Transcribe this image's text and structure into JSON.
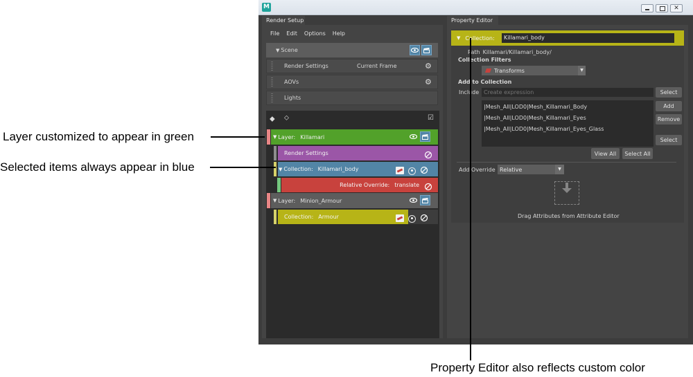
{
  "annotations": {
    "green": "Layer customized to appear in green",
    "blue": "Selected items always appear in blue",
    "property": "Property Editor also reflects custom color"
  },
  "window": {
    "app_icon": "M",
    "controls": [
      "minimize-icon",
      "restore-icon",
      "close-icon"
    ]
  },
  "render_setup": {
    "tab": "Render Setup",
    "menu": [
      "File",
      "Edit",
      "Options",
      "Help"
    ],
    "scene": {
      "label": "Scene",
      "items": [
        {
          "label": "Render Settings",
          "value": "Current Frame"
        },
        {
          "label": "AOVs",
          "value": ""
        },
        {
          "label": "Lights",
          "value": ""
        }
      ]
    },
    "tree": {
      "layer1": {
        "prefix": "Layer:",
        "name": "Killamari",
        "color": "#52a12a"
      },
      "render_settings": {
        "label": "Render Settings",
        "color": "#9b56a7"
      },
      "collection1": {
        "prefix": "Collection:",
        "name": "Killamari_body",
        "color": "#5285a6"
      },
      "override": {
        "label": "Relative Override:",
        "value": "translate",
        "color": "#c8423d"
      },
      "layer2": {
        "prefix": "Layer:",
        "name": "Minion_Armour",
        "color": "#5d5d5d"
      },
      "collection2": {
        "prefix": "Collection:",
        "name": "Armour",
        "color": "#b7b417"
      }
    }
  },
  "property_editor": {
    "tab": "Property Editor",
    "collection_label": "Collection:",
    "collection_name": "Killamari_body",
    "accent": "#b7b417",
    "path_label": "Path",
    "path_value": "Killamari/Killamari_body/",
    "filters_label": "Collection Filters",
    "filter_value": "Transforms",
    "add_to_collection": "Add to Collection",
    "include_label": "Include",
    "include_placeholder": "Create expression",
    "select_btn": "Select",
    "members": [
      "|Mesh_All|LOD0|Mesh_Killamari_Body",
      "|Mesh_All|LOD0|Mesh_Killamari_Eyes",
      "|Mesh_All|LOD0|Mesh_Killamari_Eyes_Glass"
    ],
    "add_btn": "Add",
    "remove_btn": "Remove",
    "select_btn2": "Select",
    "view_all_btn": "View All",
    "select_all_btn": "Select All",
    "add_override_label": "Add Override",
    "override_value": "Relative",
    "drop_hint": "Drag Attributes from Attribute Editor"
  }
}
